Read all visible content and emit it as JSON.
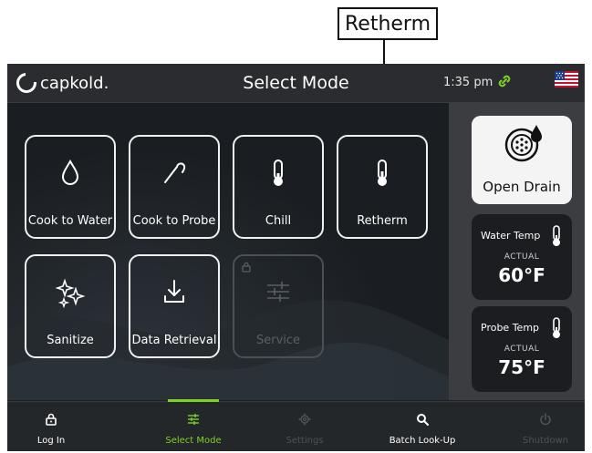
{
  "callout": {
    "label": "Retherm"
  },
  "header": {
    "brand": "capkold.",
    "title": "Select Mode",
    "time": "1:35 pm",
    "link_icon": "link-icon",
    "flag": "us-flag-icon"
  },
  "tiles": [
    {
      "label": "Cook to Water",
      "icon": "droplet-icon",
      "enabled": true
    },
    {
      "label": "Cook to Probe",
      "icon": "probe-icon",
      "enabled": true
    },
    {
      "label": "Chill",
      "icon": "thermometer-low-icon",
      "enabled": true
    },
    {
      "label": "Retherm",
      "icon": "thermometer-icon",
      "enabled": true
    },
    {
      "label": "Sanitize",
      "icon": "sparkle-icon",
      "enabled": true
    },
    {
      "label": "Data Retrieval",
      "icon": "download-icon",
      "enabled": true
    },
    {
      "label": "Service",
      "icon": "sliders-icon",
      "enabled": false
    }
  ],
  "side": {
    "drain": {
      "label": "Open Drain"
    },
    "water": {
      "name": "Water Temp",
      "caption": "ACTUAL",
      "value": "60°F"
    },
    "probe": {
      "name": "Probe Temp",
      "caption": "ACTUAL",
      "value": "75°F"
    }
  },
  "nav": [
    {
      "label": "Log In",
      "icon": "lock-icon"
    },
    {
      "label": "Select Mode",
      "icon": "sliders-icon"
    },
    {
      "label": "Settings",
      "icon": "gear-icon"
    },
    {
      "label": "Batch Look-Up",
      "icon": "search-icon"
    },
    {
      "label": "Shutdown",
      "icon": "power-icon"
    }
  ],
  "colors": {
    "accent": "#7ed321",
    "background": "#1f2225",
    "panel": "#3b3d40"
  }
}
